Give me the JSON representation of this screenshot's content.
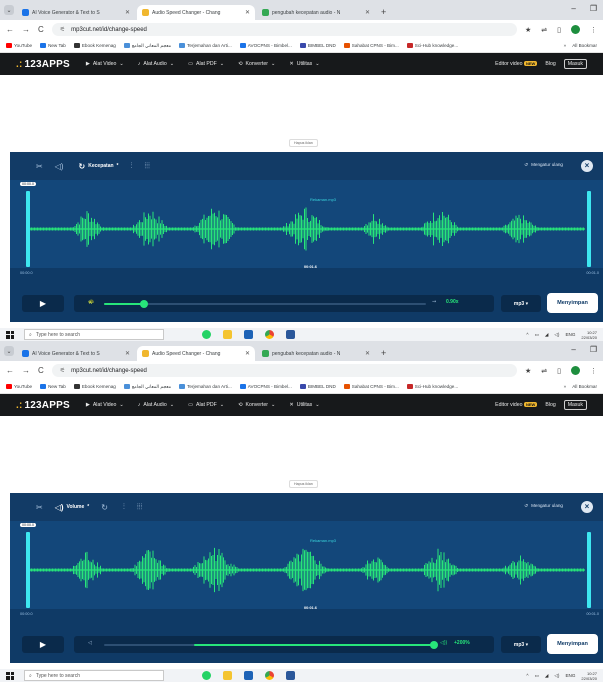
{
  "browser": {
    "tabs": [
      {
        "label": "AI Voice Generator & Text to S",
        "favicon_color": "#1a73e8",
        "active": false
      },
      {
        "label": "Audio Speed Changer - Chang",
        "favicon_color": "#f0b72f",
        "active": true
      },
      {
        "label": "pengubah kecepatan audio - N",
        "favicon_color": "#34a853",
        "active": false
      }
    ],
    "url": "mp3cut.net/id/change-speed",
    "bookmarks": [
      {
        "label": "YouTube",
        "color": "#ff0000"
      },
      {
        "label": "New Tab",
        "color": "#1a73e8"
      },
      {
        "label": "Ebook Kemenag",
        "color": "#333333"
      },
      {
        "label": "معجم المعاني الجامع",
        "color": "#4a90d9"
      },
      {
        "label": "Terjemahan dan Arti...",
        "color": "#4a90d9"
      },
      {
        "label": "AVOCPNS - Bimbel...",
        "color": "#1a73e8"
      },
      {
        "label": "BIMBEL DND",
        "color": "#3949ab"
      },
      {
        "label": "Sahabat CPNS - Bim...",
        "color": "#e65100"
      },
      {
        "label": "Sci-Hub knowledge...",
        "color": "#c62828"
      }
    ],
    "all_bookmarks": "All Bookmar"
  },
  "site": {
    "logo": "123APPS",
    "nav": [
      "Alat Video",
      "Alat Audio",
      "Alat PDF",
      "Konverter",
      "Utilitas"
    ],
    "editor_video": "Editor video",
    "new_badge": "NEW",
    "blog": "Blog",
    "login": "Masuk"
  },
  "page": {
    "remove_ads": "Hapus iklan"
  },
  "screens": [
    {
      "selected_tool": "Kecepatan",
      "selected_tool_badge": "*",
      "reset": "Mengatur ulang",
      "start_time": "00:00.0",
      "file_name": "Rekaman.mp3",
      "playhead": "00:01.6",
      "time_start": "00:00.0",
      "time_end": "00:01.0",
      "slider_value": "0.90x",
      "slider_fraction": 0.21,
      "format": "mp3",
      "save": "Menyimpan"
    },
    {
      "selected_tool": "Volume",
      "selected_tool_badge": "*",
      "reset": "Mengatur ulang",
      "start_time": "00:00.0",
      "file_name": "Rekaman.mp3",
      "playhead": "00:01.6",
      "time_start": "00:00.0",
      "time_end": "00:01.0",
      "slider_value": "+200%",
      "slider_fraction": 1.0,
      "format": "mp3",
      "save": "Menyimpan"
    }
  ],
  "taskbar": {
    "search_placeholder": "Type here to search",
    "lang": "ENG",
    "time": "10:27",
    "date": "22/03/20"
  },
  "colors": {
    "editor_bg": "#0f3a66",
    "waveform": "#27e57a",
    "handle": "#3ee7f0"
  }
}
